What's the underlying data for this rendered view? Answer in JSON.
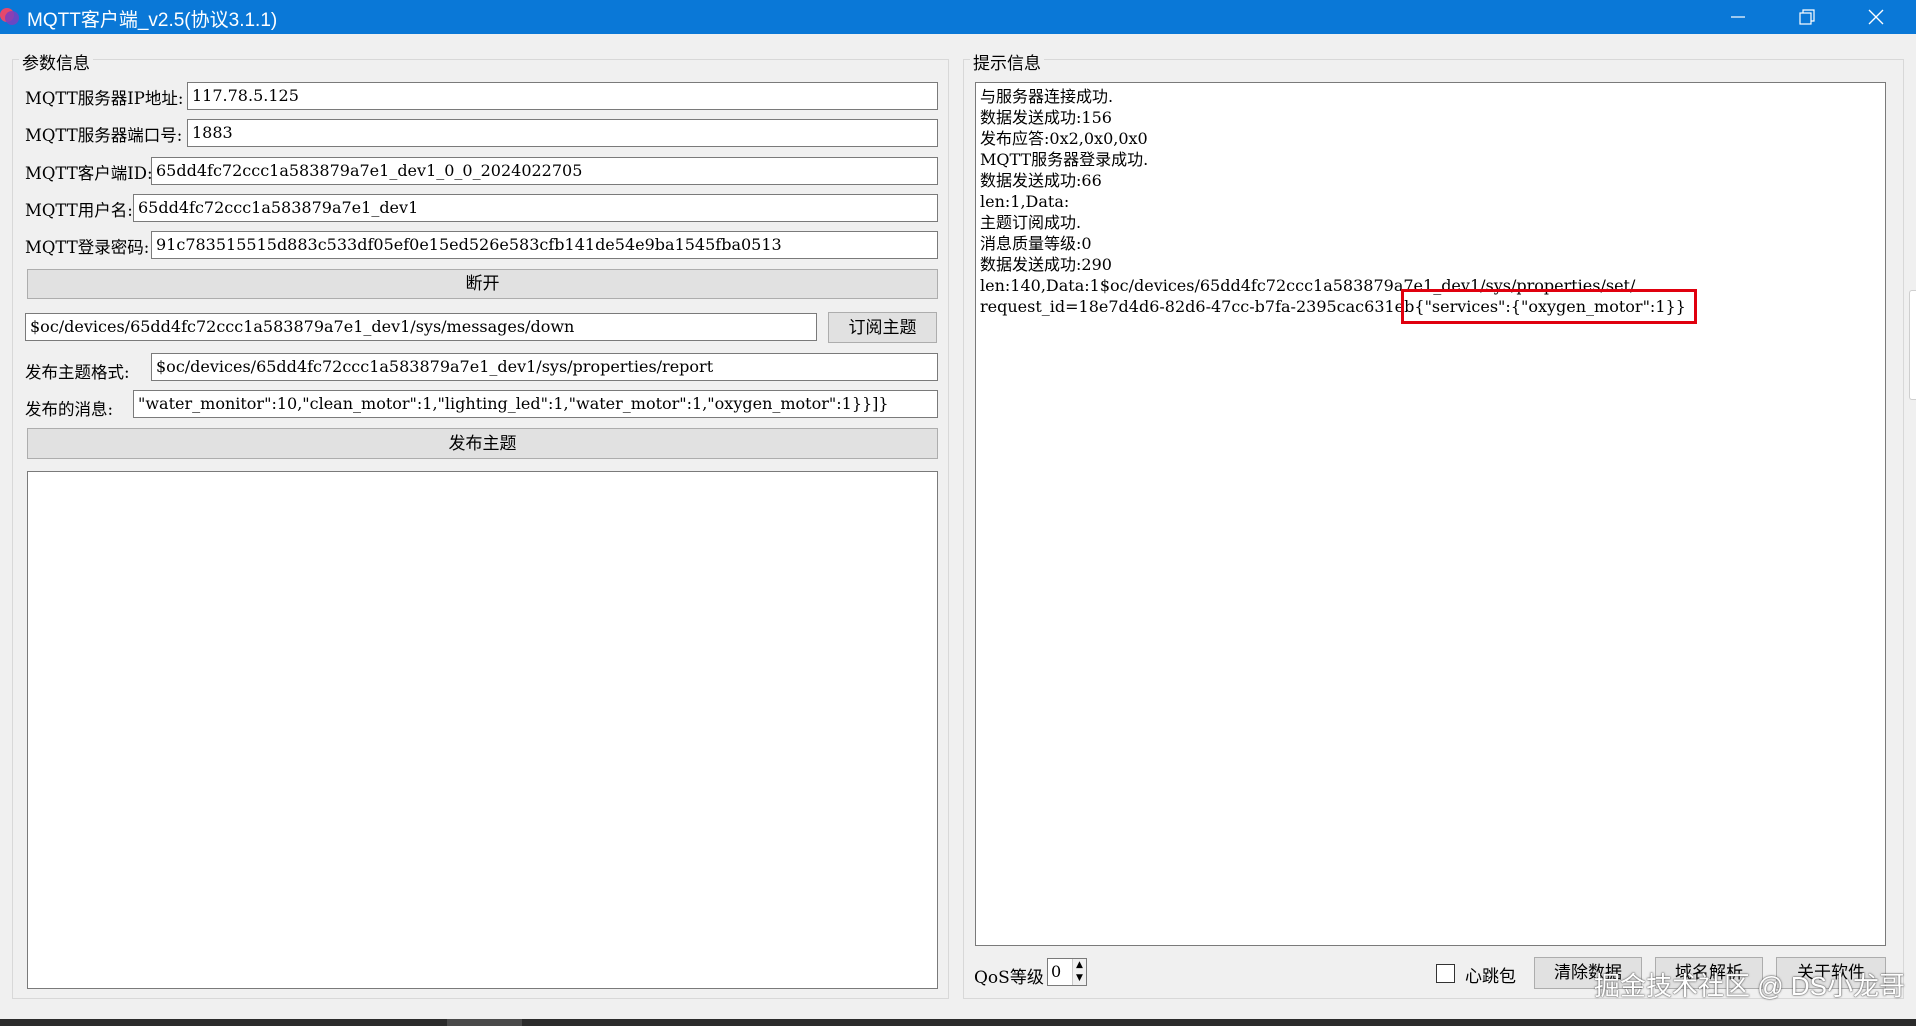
{
  "window": {
    "title": "MQTT客户端_v2.5(协议3.1.1)",
    "accent": "#0a78d7"
  },
  "params": {
    "group_title": "参数信息",
    "ip_label": "MQTT服务器IP地址:",
    "ip_value": "117.78.5.125",
    "port_label": "MQTT服务器端口号:",
    "port_value": "1883",
    "client_id_label": "MQTT客户端ID:",
    "client_id_value": "65dd4fc72ccc1a583879a7e1_dev1_0_0_2024022705",
    "username_label": "MQTT用户名:",
    "username_value": "65dd4fc72ccc1a583879a7e1_dev1",
    "password_label": "MQTT登录密码:",
    "password_value": "91c783515515d883c533df05ef0e15ed526e583cfb141de54e9ba1545fba0513",
    "disconnect_label": "断开",
    "subscribe_topic_value": "$oc/devices/65dd4fc72ccc1a583879a7e1_dev1/sys/messages/down",
    "subscribe_label": "订阅主题",
    "publish_format_label": "发布主题格式:",
    "publish_format_value": "$oc/devices/65dd4fc72ccc1a583879a7e1_dev1/sys/properties/report",
    "publish_message_label": "发布的消息:",
    "publish_message_value": "\"water_monitor\":10,\"clean_motor\":1,\"lighting_led\":1,\"water_motor\":1,\"oxygen_motor\":1}}]}",
    "publish_label": "发布主题"
  },
  "hints": {
    "group_title": "提示信息",
    "log": [
      "与服务器连接成功.",
      "数据发送成功:156",
      "发布应答:0x2,0x0,0x0",
      "MQTT服务器登录成功.",
      "数据发送成功:66",
      "len:1,Data:",
      "主题订阅成功.",
      "消息质量等级:0",
      "数据发送成功:290",
      "len:140,Data:1$oc/devices/65dd4fc72ccc1a583879a7e1_dev1/sys/properties/set/",
      "request_id=18e7d4d6-82d6-47cc-b7fa-2395cac631eb{\"services\":{\"oxygen_motor\":1}}"
    ],
    "highlight_color": "#e0000e"
  },
  "bottom": {
    "qos_label": "QoS等级",
    "qos_value": "0",
    "heartbeat_label": "心跳包",
    "clear_label": "清除数据",
    "dns_label": "域名解析",
    "about_label": "关于软件"
  },
  "watermark": "掘金技术社区 @ DS小龙哥"
}
